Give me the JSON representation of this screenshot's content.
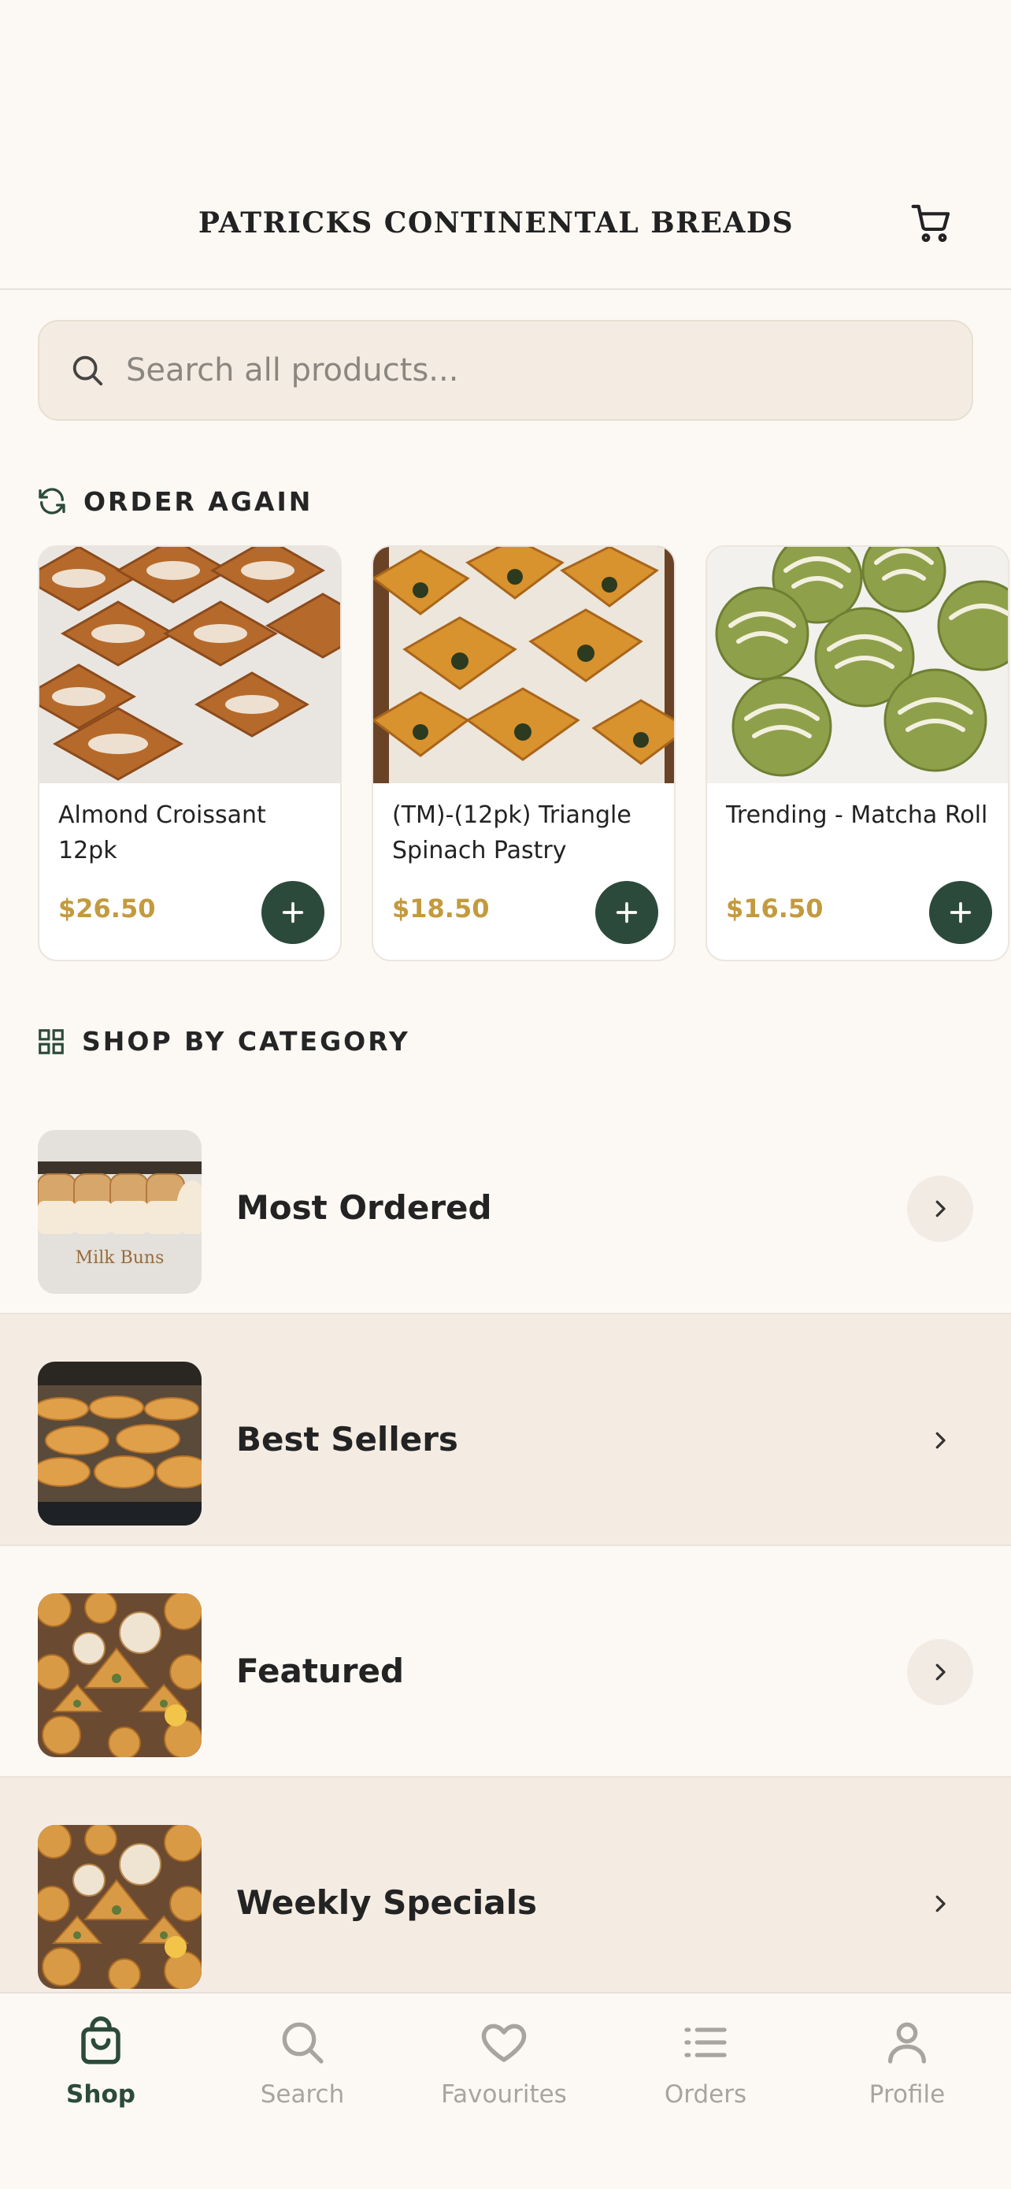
{
  "header": {
    "brand": "PATRICKS CONTINENTAL BREADS",
    "cart_icon": "cart-icon"
  },
  "search": {
    "placeholder": "Search all products..."
  },
  "order_again": {
    "title": "ORDER AGAIN",
    "icon": "refresh-icon",
    "items": [
      {
        "name": "Almond Croissant 12pk",
        "price": "$26.50"
      },
      {
        "name": "(TM)-(12pk) Triangle Spinach Pastry",
        "price": "$18.50"
      },
      {
        "name": "Trending - Matcha Roll",
        "price": "$16.50"
      }
    ]
  },
  "categories": {
    "title": "SHOP BY CATEGORY",
    "icon": "grid-icon",
    "items": [
      {
        "label": "Most Ordered",
        "thumb_text": "Milk Buns"
      },
      {
        "label": "Best Sellers"
      },
      {
        "label": "Featured"
      },
      {
        "label": "Weekly Specials"
      }
    ]
  },
  "tabbar": {
    "active": "Shop",
    "tabs": [
      {
        "label": "Shop",
        "icon": "bag-icon"
      },
      {
        "label": "Search",
        "icon": "search-icon"
      },
      {
        "label": "Favourites",
        "icon": "heart-icon"
      },
      {
        "label": "Orders",
        "icon": "list-icon"
      },
      {
        "label": "Profile",
        "icon": "person-icon"
      }
    ]
  },
  "colors": {
    "background": "#fcf9f5",
    "accent_green": "#2c4a3b",
    "price_gold": "#c39a3e",
    "alt_row": "#f4ece3"
  }
}
